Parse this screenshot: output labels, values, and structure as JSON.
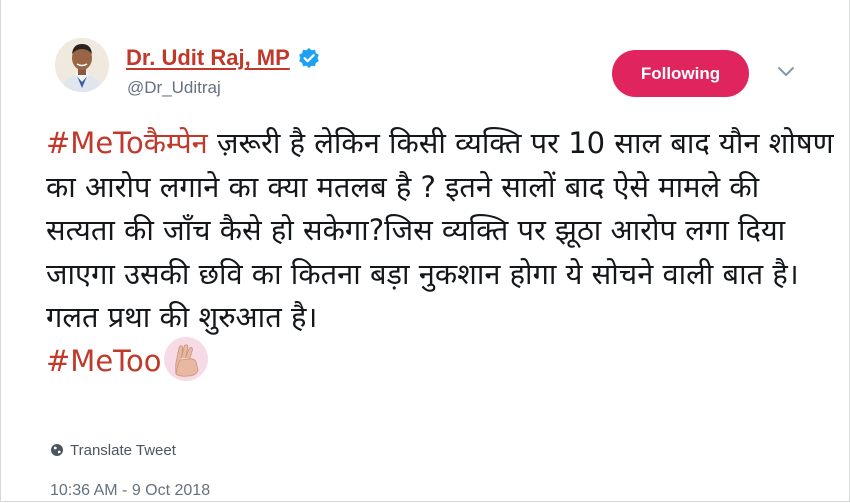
{
  "author": {
    "display_name": "Dr. Udit Raj, MP",
    "handle": "@Dr_Uditraj",
    "verified_icon": "verified-badge-icon",
    "avatar_icon": "profile-photo"
  },
  "follow_button": {
    "label": "Following"
  },
  "menu": {
    "icon": "chevron-down-icon"
  },
  "tweet": {
    "hashtag_campaign": "#MeToकैम्पेन",
    "body": " ज़रूरी है लेकिन किसी व्यक्ति पर 10 साल बाद यौन शोषण का आरोप लगाने का क्या मतलब है ? इतने सालों बाद ऐसे मामले की सत्यता की जाँच कैसे हो सकेगा?जिस व्यक्ति पर झूठा आरोप लगा दिया जाएगा उसकी छवि का कितना बड़ा नुकशान होगा ये सोचने वाली बात है।गलत प्रथा की शुरुआत है।",
    "hashtag_end": "#MeToo",
    "emoji_icon": "raised-hand-emoji"
  },
  "translate": {
    "label": "Translate Tweet",
    "icon": "globe-icon"
  },
  "timestamp": "10:36 AM - 9 Oct 2018",
  "colors": {
    "name_red": "#c0392b",
    "follow_pink": "#e0245e",
    "verified_blue": "#1da1f2",
    "muted_gray": "#65717d"
  }
}
